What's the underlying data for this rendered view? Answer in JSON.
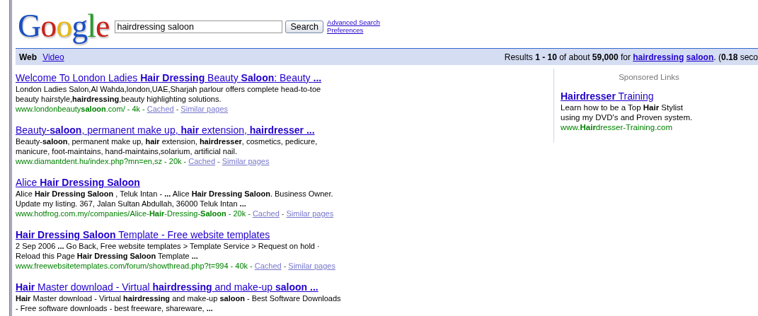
{
  "logo": {
    "letters": [
      {
        "char": "G",
        "color": "#1a4fc4"
      },
      {
        "char": "o",
        "color": "#c8231b"
      },
      {
        "char": "o",
        "color": "#e8b60e"
      },
      {
        "char": "g",
        "color": "#1a4fc4"
      },
      {
        "char": "l",
        "color": "#2a9a2f"
      },
      {
        "char": "e",
        "color": "#c8231b"
      }
    ]
  },
  "search": {
    "value": "hairdressing saloon",
    "button": "Search",
    "links": [
      "Advanced Search",
      "Preferences"
    ]
  },
  "separator": "-",
  "tabs": [
    {
      "label": "Web",
      "selected": true
    },
    {
      "label": "Video",
      "selected": false
    }
  ],
  "results_summary": {
    "before": "Results **1 - 10** of about **59,000** for ",
    "query_links": [
      "hairdressing",
      "saloon"
    ],
    "after": ". (**0.18** seco"
  },
  "results": [
    {
      "title": "Welcome To London Ladies **Hair Dressing** Beauty **Saloon**: Beauty **...**",
      "snippet": [
        "London Ladies Salon,Al Wahda,london,UAE,Sharjah parlour offers complete head-to-toe",
        "beauty hairstyle,**hairdressing**,beauty highlighting solutions."
      ],
      "url": "www.londonbeauty**saloon**.com/ - 4k",
      "cached": "Cached",
      "similar": "Similar pages"
    },
    {
      "title": "Beauty-**saloon**, permanent make up, **hair** extension, **hairdresser ...**",
      "snippet": [
        "Beauty-**saloon**, permanent make up, **hair** extension, **hairdresser**, cosmetics, pedicure,",
        "manicure, foot-maintains, hand-maintains,solarium, artificial nail."
      ],
      "url": "www.diamantdent.hu/index.php?mn=en,sz - 20k",
      "cached": "Cached",
      "similar": "Similar pages"
    },
    {
      "title": "Alice **Hair Dressing Saloon**",
      "snippet": [
        "Alice **Hair Dressing Saloon** , Teluk Intan - **...** Alice **Hair Dressing Saloon**. Business Owner.",
        "Update my listing. 367, Jalan Sultan Abdullah, 36000 Teluk Intan **...**"
      ],
      "url": "www.hotfrog.com.my/companies/Alice-**Hair**-Dressing-**Saloon** - 20k",
      "cached": "Cached",
      "similar": "Similar pages"
    },
    {
      "title": "**Hair Dressing Saloon** Template - Free website templates",
      "snippet": [
        "2 Sep 2006 **...** Go Back, Free website templates > Template Service > Request on hold ·",
        "Reload this Page **Hair Dressing Saloon** Template **...**"
      ],
      "url": "www.freewebsitetemplates.com/forum/showthread.php?t=994 - 40k",
      "cached": "Cached",
      "similar": "Similar pages"
    },
    {
      "title": "**Hair** Master download - Virtual **hairdressing** and make-up **saloon ...**",
      "snippet": [
        "**Hair** Master download - Virtual **hairdressing** and make-up **saloon** - Best Software Downloads",
        "- Free software downloads - best freeware, shareware, **...**"
      ]
    }
  ],
  "sponsored": {
    "heading": "Sponsored Links",
    "ads": [
      {
        "title": "**Hairdresser** Training",
        "text": [
          "Learn how to be a Top **Hair** Stylist",
          "using my DVD's and Proven system."
        ],
        "url": "www.**Hair**dresser-Training.com"
      }
    ]
  }
}
